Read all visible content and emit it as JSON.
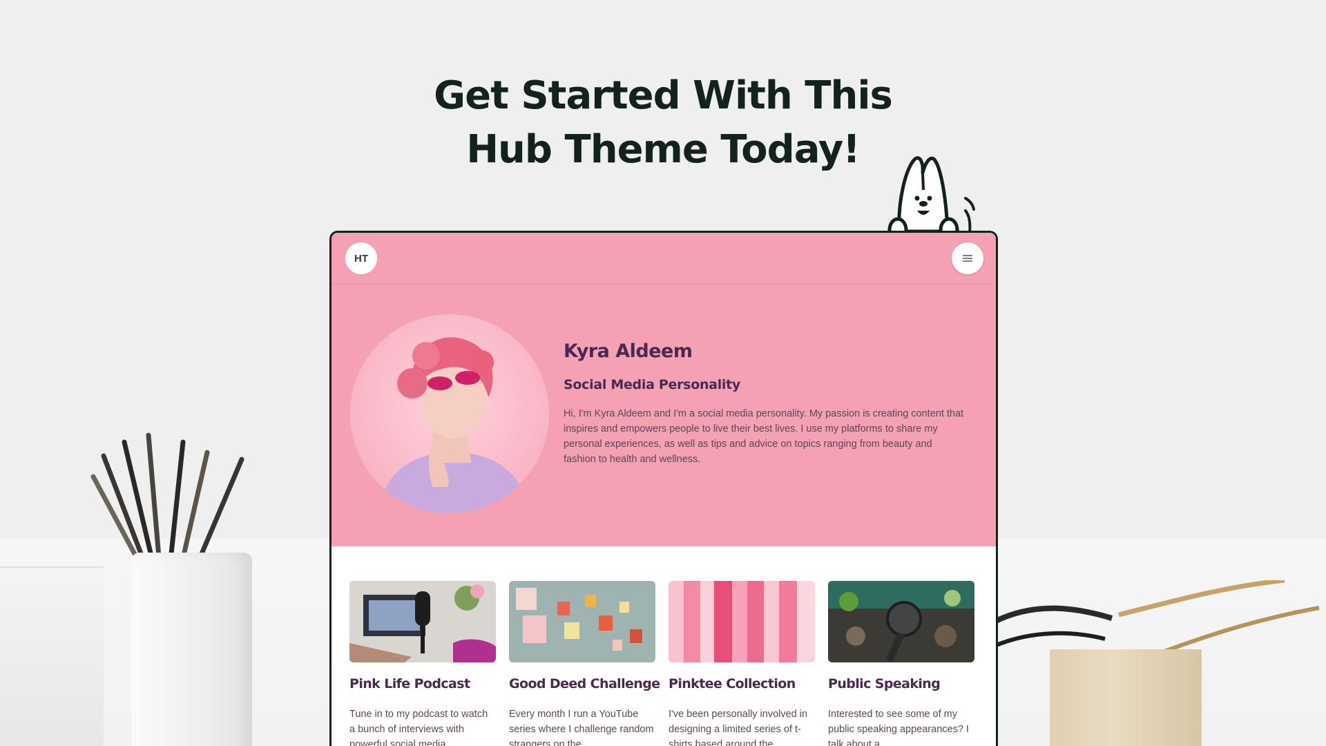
{
  "headline": {
    "line1": "Get Started With This",
    "line2": "Hub Theme Today!"
  },
  "site": {
    "logo_text": "HT",
    "menu_icon": "hamburger-icon",
    "accent_color": "#f4a1b4",
    "heading_color": "#4a2850"
  },
  "hero": {
    "name": "Kyra Aldeem",
    "role": "Social Media Personality",
    "bio": "Hi, I'm Kyra Aldeem and I'm a social media personality. My passion is creating content that inspires and empowers people to live their best lives. I use my platforms to share my personal experiences, as well as tips and advice on topics ranging from beauty and fashion to health and wellness."
  },
  "cards": [
    {
      "title": "Pink Life Podcast",
      "text": "Tune in to my podcast to watch a bunch of interviews with powerful social media"
    },
    {
      "title": "Good Deed Challenge",
      "text": "Every month I run a YouTube series where I challenge random strangers on the"
    },
    {
      "title": "Pinktee Collection",
      "text": "I've been personally involved in designing a limited series of t-shirts based around the"
    },
    {
      "title": "Public Speaking",
      "text": "Interested to see some of my public speaking appearances? I talk about a"
    }
  ]
}
